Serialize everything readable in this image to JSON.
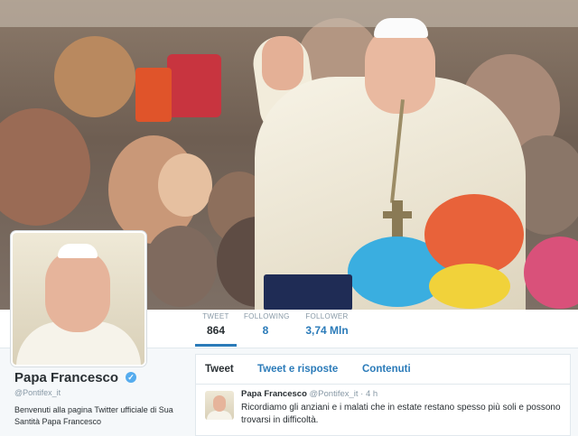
{
  "profile": {
    "name": "Papa Francesco",
    "handle": "@Pontifex_it",
    "bio": "Benvenuti alla pagina Twitter ufficiale di Sua Santità Papa Francesco"
  },
  "stats": [
    {
      "label": "TWEET",
      "value": "864"
    },
    {
      "label": "FOLLOWING",
      "value": "8"
    },
    {
      "label": "FOLLOWER",
      "value": "3,74 Mln"
    }
  ],
  "tabs": [
    {
      "label": "Tweet"
    },
    {
      "label": "Tweet e risposte"
    },
    {
      "label": "Contenuti"
    }
  ],
  "tweet": {
    "author": "Papa Francesco",
    "meta": "@Pontifex_it · 4 h",
    "text": "Ricordiamo gli anziani e i malati che in estate restano spesso più soli e possono trovarsi in difficoltà."
  },
  "colors": {
    "accent": "#2b7bb9",
    "verified": "#55acee",
    "text": "#292f33",
    "muted": "#8899a6"
  },
  "icons": {
    "verified": "verified-badge-icon"
  }
}
